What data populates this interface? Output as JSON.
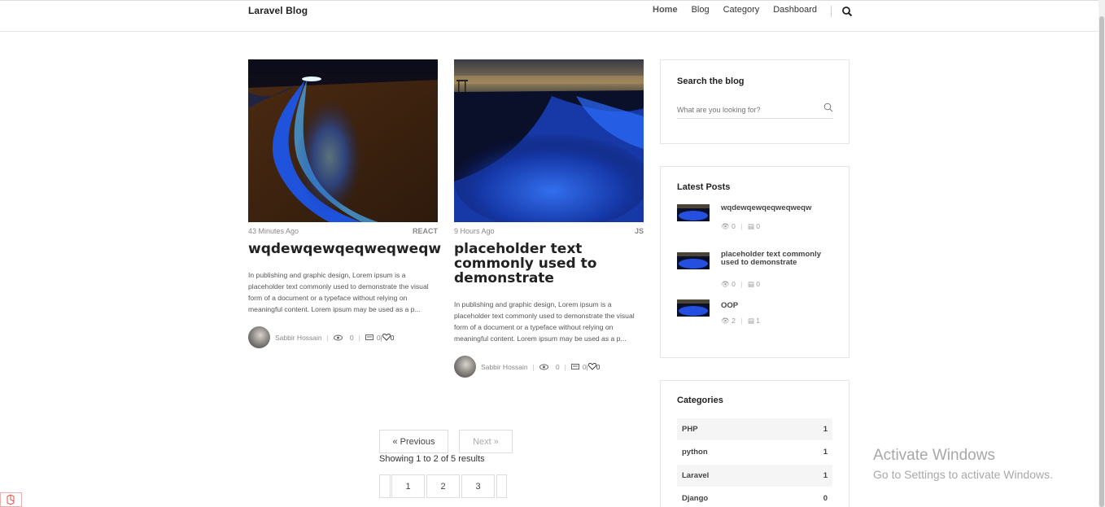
{
  "header": {
    "brand": "Laravel Blog",
    "nav": [
      {
        "label": "Home",
        "active": true
      },
      {
        "label": "Blog",
        "active": false
      },
      {
        "label": "Category",
        "active": false
      },
      {
        "label": "Dashboard",
        "active": false
      }
    ],
    "search_icon": "search-icon"
  },
  "posts": [
    {
      "time": "43 Minutes Ago",
      "category": "REACT",
      "title": "wqdewqewqeqweqweqw",
      "excerpt": "In publishing and graphic design, Lorem ipsum is a placeholder text commonly used to demonstrate the visual form of a document or a typeface without relying on meaningful content. Lorem ipsum may be used as a p...",
      "author": "Sabbir Hossain",
      "views": "0",
      "comments": "0",
      "likes": "0"
    },
    {
      "time": "9 Hours Ago",
      "category": "JS",
      "title": "placeholder text commonly used to demonstrate",
      "excerpt": "In publishing and graphic design, Lorem ipsum is a placeholder text commonly used to demonstrate the visual form of a document or a typeface without relying on meaningful content. Lorem ipsum may be used as a p...",
      "author": "Sabbir Hossain",
      "views": "0",
      "comments": "0",
      "likes": "0"
    }
  ],
  "pagination": {
    "previous": "« Previous",
    "next": "Next »",
    "info": "Showing 1 to 2 of 5 results",
    "pages": [
      "1",
      "2",
      "3"
    ]
  },
  "sidebar": {
    "search": {
      "title": "Search the blog",
      "placeholder": "What are you looking for?"
    },
    "latest": {
      "title": "Latest Posts",
      "items": [
        {
          "title": "wqdewqewqeqweqweqw",
          "views": "0",
          "comments": "0"
        },
        {
          "title": "placeholder text commonly used to demonstrate",
          "views": "0",
          "comments": "0"
        },
        {
          "title": "OOP",
          "views": "2",
          "comments": "1"
        }
      ]
    },
    "categories": {
      "title": "Categories",
      "items": [
        {
          "name": "PHP",
          "count": "1"
        },
        {
          "name": "python",
          "count": "1"
        },
        {
          "name": "Laravel",
          "count": "1"
        },
        {
          "name": "Django",
          "count": "0"
        }
      ]
    }
  },
  "watermark": {
    "line1": "Activate Windows",
    "line2": "Go to Settings to activate Windows."
  }
}
